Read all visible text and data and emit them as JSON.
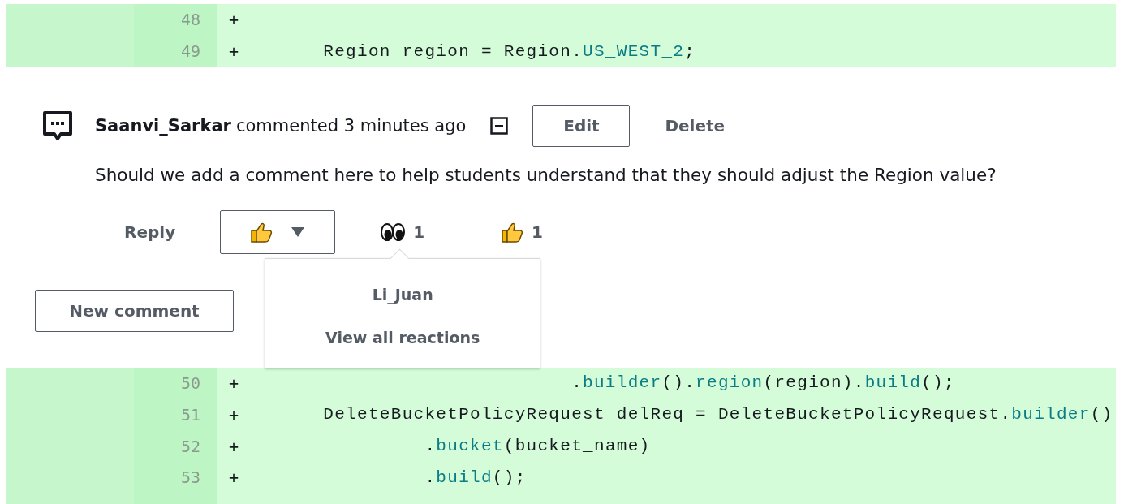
{
  "diff_top": [
    {
      "number": "48",
      "sign": "+"
    },
    {
      "number": "49",
      "sign": "+",
      "code": [
        {
          "text": "       Region region = Region.",
          "kind": "plain"
        },
        {
          "text": "US_WEST_2",
          "kind": "member"
        },
        {
          "text": ";",
          "kind": "plain"
        }
      ]
    }
  ],
  "comment": {
    "author": "Saanvi_Sarkar",
    "meta": "commented 3 minutes ago",
    "edit_button": "Edit",
    "delete_button": "Delete",
    "body": "Should we add a comment here to help students understand that they should adjust the Region value?",
    "reply_button": "Reply",
    "reactions": [
      {
        "kind": "eyes",
        "count": "1"
      },
      {
        "kind": "thumbs_up",
        "count": "1"
      }
    ],
    "popover": {
      "users": [
        "Li_Juan"
      ],
      "link": "View all reactions"
    }
  },
  "new_comment_button": "New comment",
  "diff_bottom": [
    {
      "number": "50",
      "sign": "+",
      "code": [
        {
          "text": "                             .",
          "kind": "plain"
        },
        {
          "text": "builder",
          "kind": "member"
        },
        {
          "text": "().",
          "kind": "plain"
        },
        {
          "text": "region",
          "kind": "member"
        },
        {
          "text": "(region).",
          "kind": "plain"
        },
        {
          "text": "build",
          "kind": "member"
        },
        {
          "text": "();",
          "kind": "plain"
        }
      ]
    },
    {
      "number": "51",
      "sign": "+",
      "code": [
        {
          "text": "       DeleteBucketPolicyRequest delReq = DeleteBucketPolicyRequest.",
          "kind": "plain"
        },
        {
          "text": "builder",
          "kind": "member"
        },
        {
          "text": "()",
          "kind": "plain"
        }
      ]
    },
    {
      "number": "52",
      "sign": "+",
      "code": [
        {
          "text": "                .",
          "kind": "plain"
        },
        {
          "text": "bucket",
          "kind": "member"
        },
        {
          "text": "(bucket_name)",
          "kind": "plain"
        }
      ]
    },
    {
      "number": "53",
      "sign": "+",
      "code": [
        {
          "text": "                .",
          "kind": "plain"
        },
        {
          "text": "build",
          "kind": "member"
        },
        {
          "text": "();",
          "kind": "plain"
        }
      ]
    }
  ]
}
